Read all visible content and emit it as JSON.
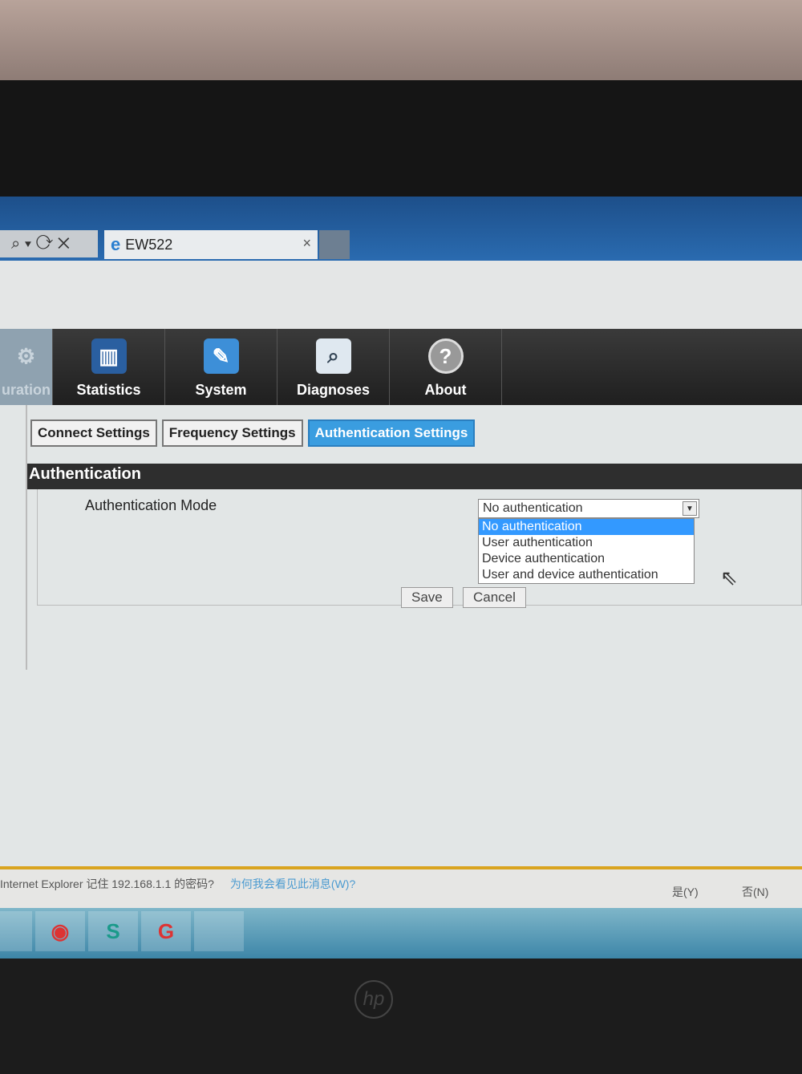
{
  "browser": {
    "tab_title": "EW522",
    "close": "×",
    "address_icons": "⌕ ▾ ⟳ ✕"
  },
  "nav": {
    "items": [
      {
        "label": "uration"
      },
      {
        "label": "Statistics"
      },
      {
        "label": "System"
      },
      {
        "label": "Diagnoses"
      },
      {
        "label": "About"
      }
    ]
  },
  "subtabs": [
    {
      "label": "Connect Settings"
    },
    {
      "label": "Frequency Settings"
    },
    {
      "label": "Authentication Settings",
      "active": true
    }
  ],
  "section": {
    "title": "Authentication"
  },
  "form": {
    "mode_label": "Authentication Mode",
    "selected": "No authentication",
    "options": [
      "No authentication",
      "User authentication",
      "Device authentication",
      "User and device authentication"
    ],
    "save": "Save",
    "cancel": "Cancel"
  },
  "notification": {
    "message": "Internet Explorer 记住 192.168.1.1 的密码?",
    "link": "为何我会看见此消息(W)?",
    "yes": "是(Y)",
    "no": "否(N)"
  },
  "colors": {
    "active_tab": "#3a9de0",
    "selected_option": "#3399ff",
    "notification_bar": "#d9a420"
  }
}
